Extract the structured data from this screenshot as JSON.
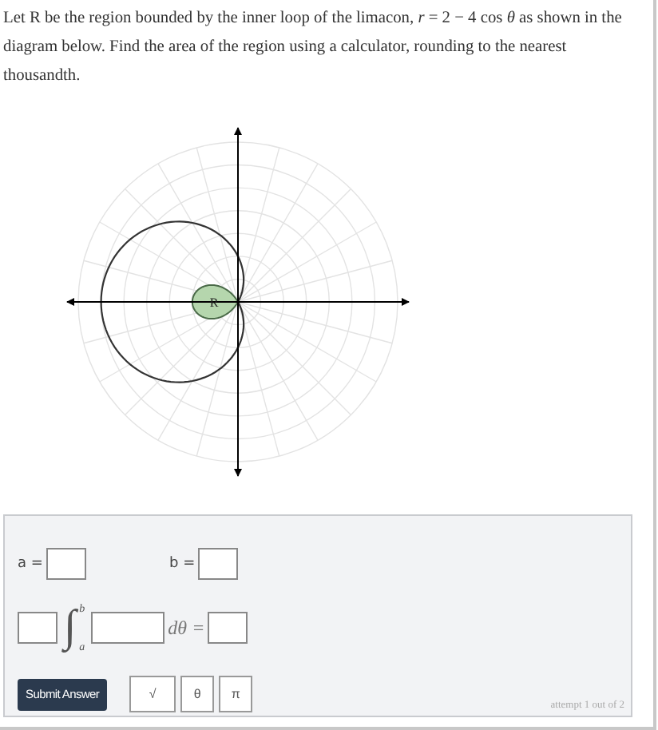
{
  "question": "Let R be the region bounded by the inner loop of the limacon, *r* = 2 − 4 cos *θ* as shown in the diagram below. Find the area of the region using a calculator, rounding to the nearest thousandth.",
  "diagram": {
    "region_label": "R"
  },
  "bounds": [
    {
      "label": "a ="
    },
    {
      "label": "b ="
    }
  ],
  "integral": {
    "sign": "∫",
    "lower": "a",
    "upper": "b",
    "differential": "dθ ="
  },
  "submit": "Submit Answer",
  "symbol_buttons": [
    "√",
    "θ",
    "π"
  ],
  "attempt": "attempt 1 out of 2"
}
